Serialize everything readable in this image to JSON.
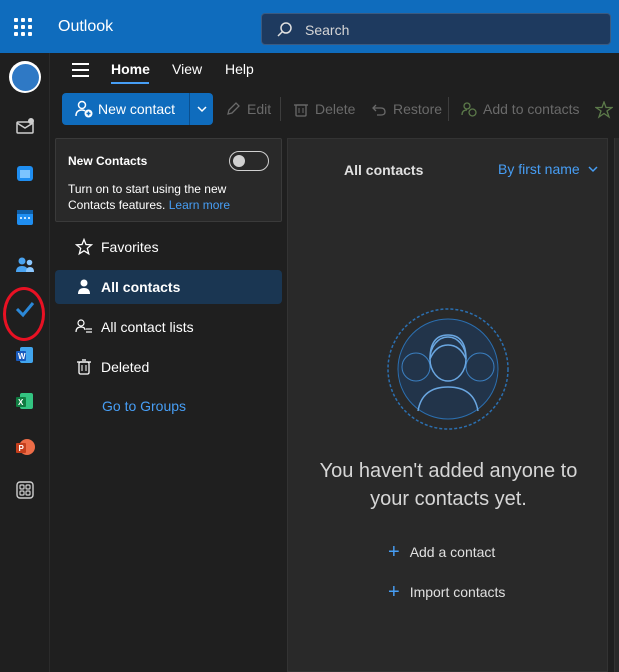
{
  "app": {
    "title": "Outlook"
  },
  "search": {
    "placeholder": "Search"
  },
  "menu": {
    "tabs": [
      "Home",
      "View",
      "Help"
    ]
  },
  "ribbon": {
    "new_contact": "New contact",
    "edit": "Edit",
    "delete": "Delete",
    "restore": "Restore",
    "add_to_contacts": "Add to contacts"
  },
  "new_contacts_card": {
    "title": "New Contacts",
    "description": "Turn on to start using the new Contacts features.",
    "link": "Learn more",
    "toggle_on": false
  },
  "nav": {
    "items": [
      "Favorites",
      "All contacts",
      "All contact lists",
      "Deleted"
    ],
    "selected": "All contacts",
    "groups_link": "Go to Groups"
  },
  "content": {
    "header": "All contacts",
    "sort": "By first name",
    "empty_line1": "You haven't added anyone to",
    "empty_line2": "your contacts yet.",
    "actions": [
      "Add a contact",
      "Import contacts"
    ]
  },
  "rail": {
    "icons": [
      "copilot-icon",
      "mail-icon",
      "calendar-app-icon",
      "calendar-icon",
      "people-icon",
      "todo-icon",
      "word-icon",
      "excel-icon",
      "powerpoint-icon",
      "more-apps-icon"
    ],
    "annotation": "red-circle-around-people"
  },
  "colors": {
    "accent": "#0f6cbd",
    "link": "#479ef5",
    "background": "#1f1f1f",
    "annotation": "#e81123"
  }
}
